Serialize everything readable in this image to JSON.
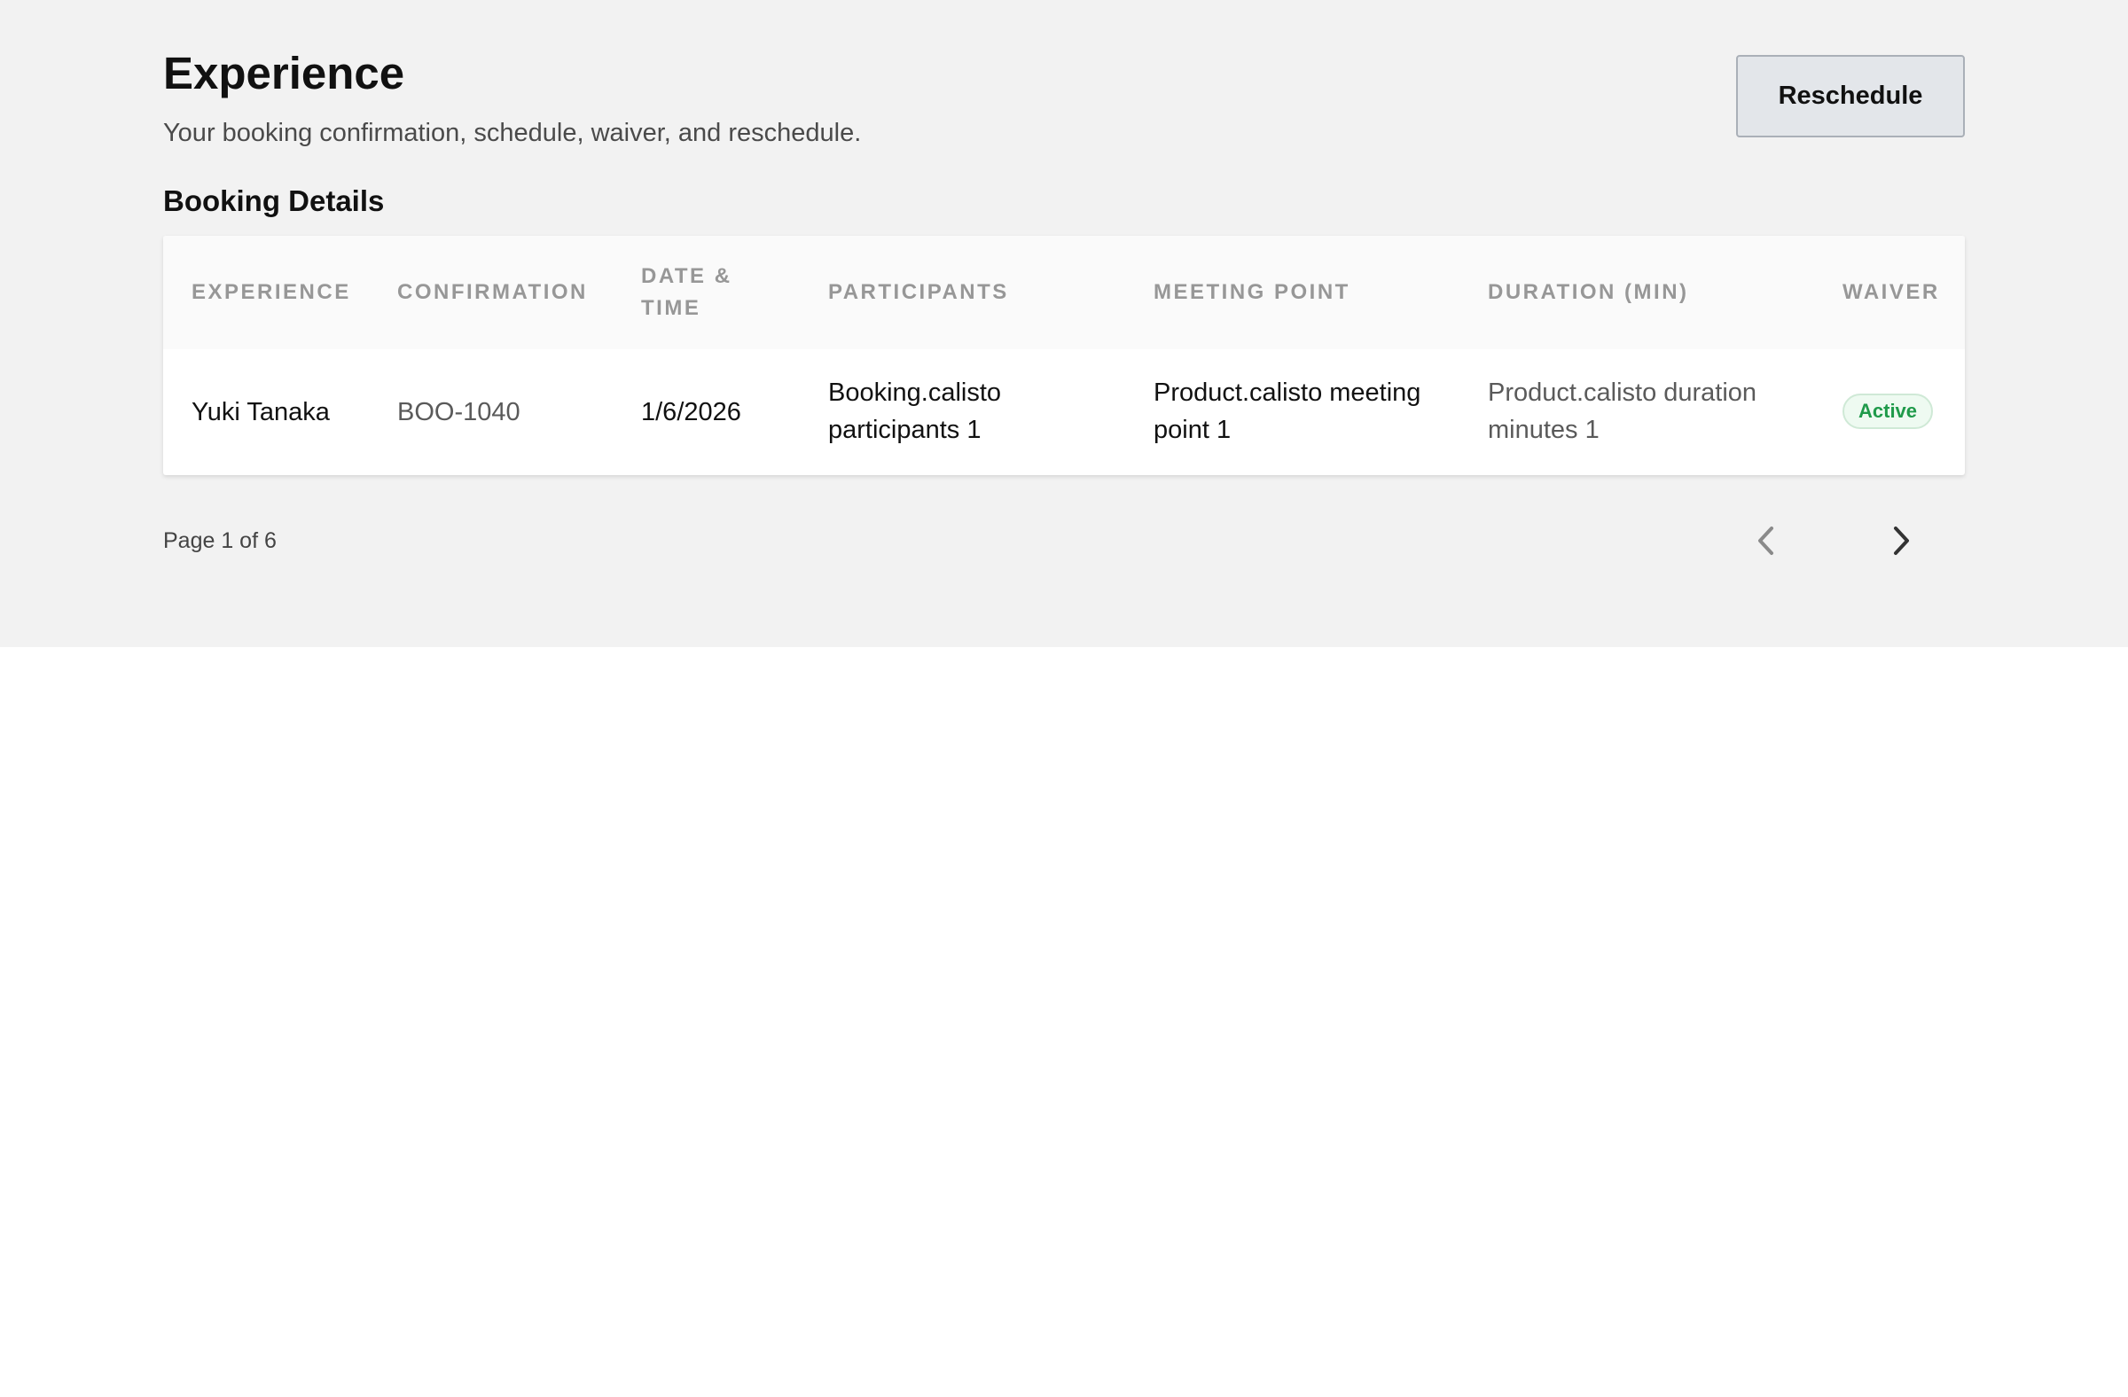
{
  "header": {
    "title": "Experience",
    "subtitle": "Your booking confirmation, schedule, waiver, and reschedule.",
    "reschedule_label": "Reschedule"
  },
  "section": {
    "title": "Booking Details"
  },
  "table": {
    "columns": [
      "EXPERIENCE",
      "CONFIRMATION",
      "DATE & TIME",
      "PARTICIPANTS",
      "MEETING POINT",
      "DURATION (MIN)",
      "WAIVER"
    ],
    "rows": [
      {
        "experience": "Yuki Tanaka",
        "confirmation": "BOO-1040",
        "date_time": "1/6/2026",
        "participants": "Booking.calisto participants 1",
        "meeting_point": "Product.calisto meeting point 1",
        "duration": "Product.calisto duration minutes 1",
        "waiver": "Active"
      }
    ]
  },
  "pagination": {
    "label": "Page 1 of 6",
    "prev_icon": "chevron-left-icon",
    "next_icon": "chevron-right-icon"
  },
  "colors": {
    "background": "#f2f2f2",
    "button_bg": "#e3e6ea",
    "badge_text": "#1f9a4a",
    "badge_bg": "#eefaf1"
  }
}
